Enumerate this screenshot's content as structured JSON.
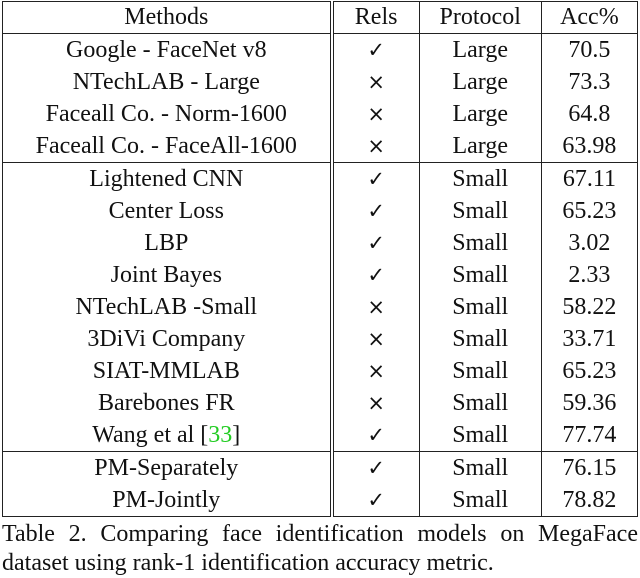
{
  "table": {
    "headers": [
      "Methods",
      "Rels",
      "Protocol",
      "Acc%"
    ],
    "groups": [
      [
        {
          "method": "Google - FaceNet v8",
          "rels": "✓",
          "protocol": "Large",
          "acc": "70.5"
        },
        {
          "method": "NTechLAB - Large",
          "rels": "×",
          "protocol": "Large",
          "acc": "73.3"
        },
        {
          "method": "Faceall Co. - Norm-1600",
          "rels": "×",
          "protocol": "Large",
          "acc": "64.8"
        },
        {
          "method": "Faceall Co. - FaceAll-1600",
          "rels": "×",
          "protocol": "Large",
          "acc": "63.98"
        }
      ],
      [
        {
          "method": "Lightened CNN",
          "rels": "✓",
          "protocol": "Small",
          "acc": "67.11"
        },
        {
          "method": "Center Loss",
          "rels": "✓",
          "protocol": "Small",
          "acc": "65.23"
        },
        {
          "method": "LBP",
          "rels": "✓",
          "protocol": "Small",
          "acc": "3.02"
        },
        {
          "method": "Joint Bayes",
          "rels": "✓",
          "protocol": "Small",
          "acc": "2.33"
        },
        {
          "method": "NTechLAB -Small",
          "rels": "×",
          "protocol": "Small",
          "acc": "58.22"
        },
        {
          "method": "3DiVi Company",
          "rels": "×",
          "protocol": "Small",
          "acc": "33.71"
        },
        {
          "method": "SIAT-MMLAB",
          "rels": "×",
          "protocol": "Small",
          "acc": "65.23"
        },
        {
          "method": "Barebones FR",
          "rels": "×",
          "protocol": "Small",
          "acc": "59.36"
        },
        {
          "method": "Wang et al [",
          "cite": "33",
          "method_suffix": "]",
          "rels": "✓",
          "protocol": "Small",
          "acc": "77.74"
        }
      ],
      [
        {
          "method": "PM-Separately",
          "rels": "✓",
          "protocol": "Small",
          "acc": "76.15"
        },
        {
          "method": "PM-Jointly",
          "rels": "✓",
          "protocol": "Small",
          "acc": "78.82",
          "bold": true
        }
      ]
    ]
  },
  "colors": {
    "citation": "#22cc22"
  },
  "caption": {
    "line1": "Table 2. Comparing face identification models on MegaFace",
    "line2": "dataset using rank-1 identification accuracy metric."
  }
}
